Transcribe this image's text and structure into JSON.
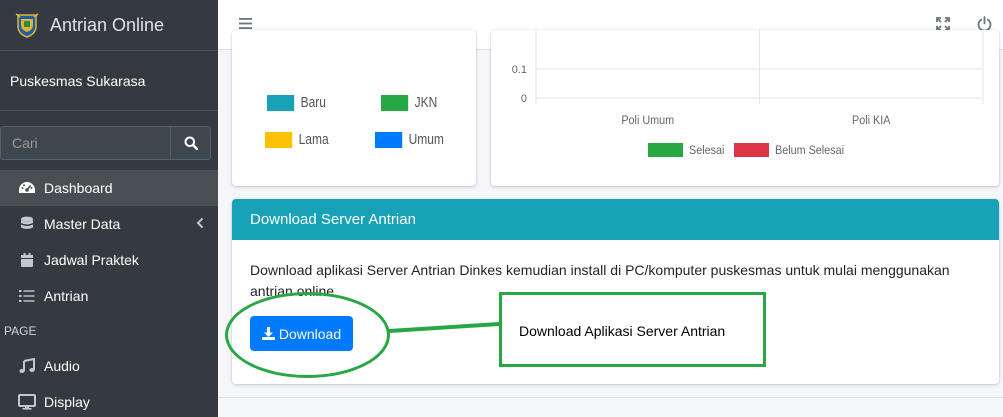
{
  "app": {
    "title": "Antrian Online",
    "logo_icon": "crest-logo-icon"
  },
  "sidebar": {
    "user_name": "Puskesmas Sukarasa",
    "search_placeholder": "Cari",
    "items": [
      {
        "label": "Dashboard",
        "icon": "dashboard-icon",
        "active": true
      },
      {
        "label": "Master Data",
        "icon": "database-icon",
        "has_submenu": true
      },
      {
        "label": "Jadwal Praktek",
        "icon": "calendar-icon"
      },
      {
        "label": "Antrian",
        "icon": "list-icon"
      }
    ],
    "section_header": "PAGE",
    "page_items": [
      {
        "label": "Audio",
        "icon": "music-icon"
      },
      {
        "label": "Display",
        "icon": "desktop-icon"
      }
    ]
  },
  "topbar": {
    "menu_icon": "hamburger-icon",
    "fullscreen_icon": "expand-icon",
    "power_icon": "power-icon"
  },
  "legend_card": {
    "items": [
      {
        "label": "Baru",
        "color": "#17a2b8"
      },
      {
        "label": "JKN",
        "color": "#28a745"
      },
      {
        "label": "Lama",
        "color": "#ffc107"
      },
      {
        "label": "Umum",
        "color": "#007bff"
      }
    ]
  },
  "chart_data": {
    "type": "bar",
    "categories": [
      "Poli Umum",
      "Poli KIA"
    ],
    "series": [
      {
        "name": "Selesai",
        "color": "#28a745",
        "values": [
          0,
          0
        ]
      },
      {
        "name": "Belum Selesai",
        "color": "#dc3545",
        "values": [
          0,
          0
        ]
      }
    ],
    "yticks": [
      "0.1",
      "0"
    ],
    "legend": "bottom"
  },
  "download_card": {
    "header": "Download Server Antrian",
    "body_text": "Download aplikasi Server Antrian Dinkes kemudian install di PC/komputer puskesmas untuk mulai menggunakan antrian online",
    "button_label": "Download",
    "button_icon": "download-icon",
    "header_color": "#17a2b8",
    "button_color": "#007bff"
  },
  "annotation": {
    "text": "Download Aplikasi Server Antrian",
    "color": "#28a745"
  }
}
